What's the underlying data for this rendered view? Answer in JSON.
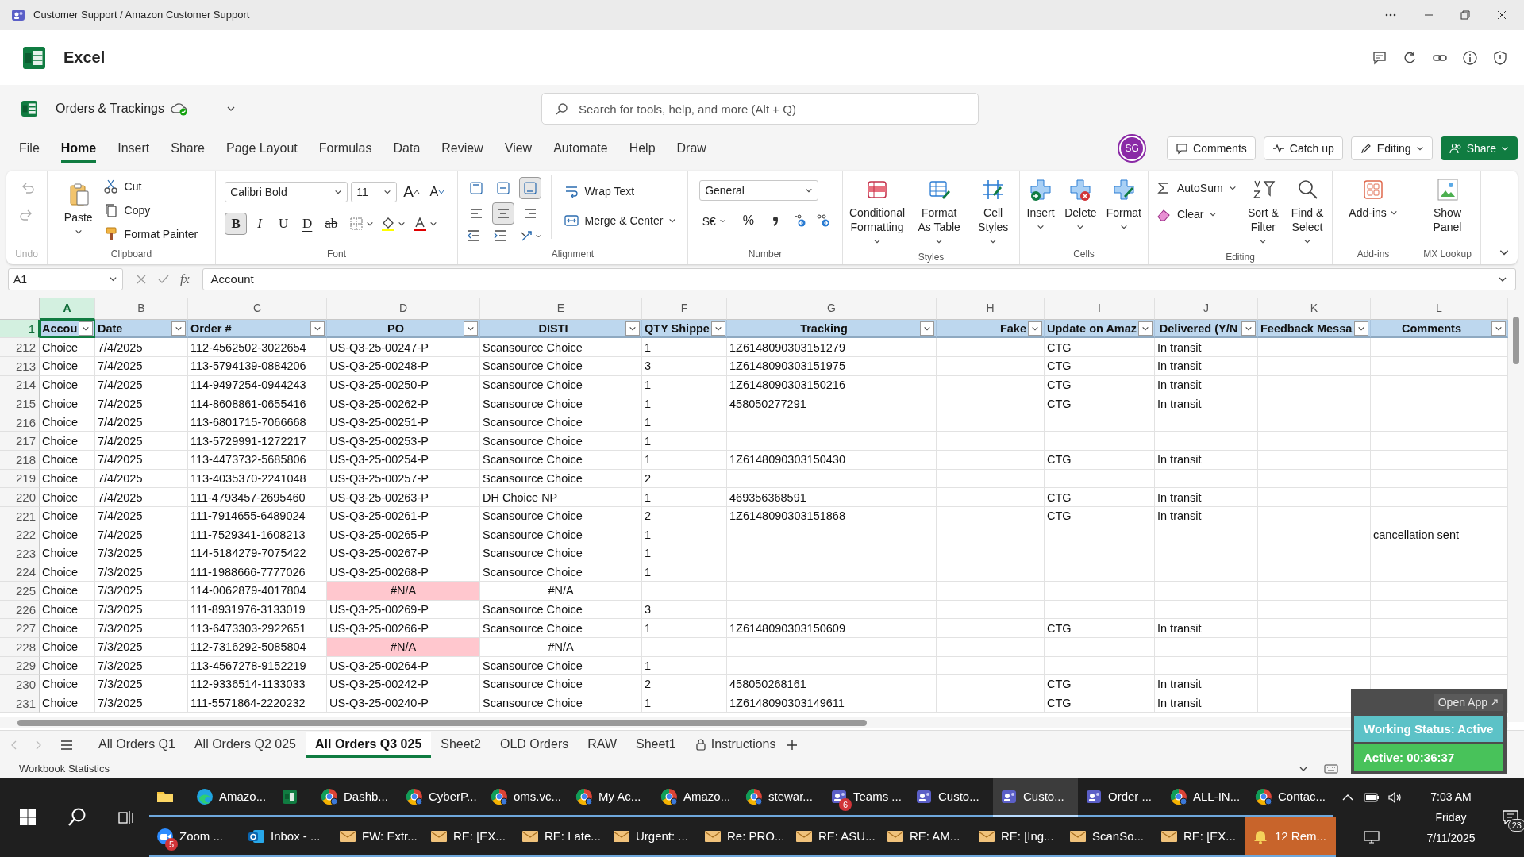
{
  "window": {
    "title": "Customer Support / Amazon Customer Support"
  },
  "app": {
    "name": "Excel"
  },
  "document": {
    "name": "Orders & Trackings"
  },
  "search": {
    "placeholder": "Search for tools, help, and more (Alt + Q)"
  },
  "menu_tabs": [
    {
      "label": "File",
      "selected": false
    },
    {
      "label": "Home",
      "selected": true
    },
    {
      "label": "Insert",
      "selected": false
    },
    {
      "label": "Share",
      "selected": false
    },
    {
      "label": "Page Layout",
      "selected": false
    },
    {
      "label": "Formulas",
      "selected": false
    },
    {
      "label": "Data",
      "selected": false
    },
    {
      "label": "Review",
      "selected": false
    },
    {
      "label": "View",
      "selected": false
    },
    {
      "label": "Automate",
      "selected": false
    },
    {
      "label": "Help",
      "selected": false
    },
    {
      "label": "Draw",
      "selected": false
    }
  ],
  "user": {
    "initials": "SG"
  },
  "actions": [
    {
      "label": "Comments",
      "kind": "outline"
    },
    {
      "label": "Catch up",
      "kind": "outline"
    },
    {
      "label": "Editing",
      "kind": "outline"
    },
    {
      "label": "Share",
      "kind": "primary"
    }
  ],
  "ribbon": {
    "groups": [
      {
        "kind": "undo",
        "label": "Undo",
        "disabled": true
      },
      {
        "kind": "clipboard",
        "label": "Clipboard",
        "paste": "Paste",
        "items": [
          "Cut",
          "Copy",
          "Format Painter"
        ]
      },
      {
        "kind": "font",
        "label": "Font",
        "font": "Calibri Bold",
        "size": "11",
        "size_buttons": [
          "A",
          "A"
        ],
        "styles": [
          {
            "label": "B",
            "selected": true
          },
          {
            "label": "I",
            "selected": false
          },
          {
            "label": "U",
            "selected": false
          },
          {
            "label": "D",
            "selected": false
          },
          {
            "label": "ab",
            "selected": false
          }
        ]
      },
      {
        "kind": "alignment",
        "label": "Alignment",
        "vertical": [
          {
            "selected": false
          },
          {
            "selected": false
          },
          {
            "selected": true
          }
        ],
        "horizontal": [
          {
            "selected": false
          },
          {
            "selected": true
          },
          {
            "selected": false
          }
        ],
        "wrap": "Wrap Text",
        "merge": "Merge & Center"
      },
      {
        "kind": "number",
        "label": "Number",
        "format": "General",
        "currency": "$€",
        "percent": "%"
      },
      {
        "kind": "large",
        "label": "Styles",
        "items": [
          {
            "label": "Conditional Formatting",
            "menu": true
          },
          {
            "label": "Format As Table",
            "menu": true
          },
          {
            "label": "Cell Styles",
            "menu": true
          }
        ]
      },
      {
        "kind": "large",
        "label": "Cells",
        "items": [
          {
            "label": "Insert",
            "menu": true
          },
          {
            "label": "Delete",
            "menu": true
          },
          {
            "label": "Format",
            "menu": true
          }
        ]
      },
      {
        "kind": "editing",
        "label": "Editing",
        "small": [
          "AutoSum",
          "Clear"
        ],
        "large": [
          "Sort & Filter",
          "Find & Select"
        ]
      },
      {
        "kind": "large",
        "label": "Add-ins",
        "items": [
          {
            "label": "Add-ins",
            "menu": true
          }
        ]
      },
      {
        "kind": "large",
        "label": "MX Lookup",
        "items": [
          {
            "label": "Show Panel",
            "menu": false
          }
        ]
      }
    ]
  },
  "formula_bar": {
    "cell": "A1",
    "fx": "fx",
    "value": "Account"
  },
  "sheet": {
    "columns": [
      {
        "label": "A",
        "selected": true
      },
      {
        "label": "B",
        "selected": false
      },
      {
        "label": "C",
        "selected": false
      },
      {
        "label": "D",
        "selected": false
      },
      {
        "label": "E",
        "selected": false
      },
      {
        "label": "F",
        "selected": false
      },
      {
        "label": "G",
        "selected": false
      },
      {
        "label": "H",
        "selected": false
      },
      {
        "label": "I",
        "selected": false
      },
      {
        "label": "J",
        "selected": false
      },
      {
        "label": "K",
        "selected": false
      },
      {
        "label": "L",
        "selected": false
      }
    ],
    "header_row": "1",
    "headers": [
      "Accou",
      "Date",
      "Order #",
      "PO",
      "DISTI",
      "QTY Shippe",
      "Tracking",
      "Fake",
      "Update on Amaz",
      "Delivered (Y/N",
      "Feedback Messa",
      "Comments"
    ],
    "rows": [
      {
        "row": "212",
        "po_error": false,
        "cells": [
          "Choice",
          "7/4/2025",
          "112-4562502-3022654",
          "US-Q3-25-00247-P",
          "Scansource Choice",
          "1",
          "1Z6148090303151279",
          null,
          "CTG",
          "In transit",
          null,
          null
        ]
      },
      {
        "row": "213",
        "po_error": false,
        "cells": [
          "Choice",
          "7/4/2025",
          "113-5794139-0884206",
          "US-Q3-25-00248-P",
          "Scansource Choice",
          "3",
          "1Z6148090303151975",
          null,
          "CTG",
          "In transit",
          null,
          null
        ]
      },
      {
        "row": "214",
        "po_error": false,
        "cells": [
          "Choice",
          "7/4/2025",
          "114-9497254-0944243",
          "US-Q3-25-00250-P",
          "Scansource Choice",
          "1",
          "1Z6148090303150216",
          null,
          "CTG",
          "In transit",
          null,
          null
        ]
      },
      {
        "row": "215",
        "po_error": false,
        "cells": [
          "Choice",
          "7/4/2025",
          "114-8608861-0655416",
          "US-Q3-25-00262-P",
          "Scansource Choice",
          "1",
          "458050277291",
          null,
          "CTG",
          "In transit",
          null,
          null
        ]
      },
      {
        "row": "216",
        "po_error": false,
        "cells": [
          "Choice",
          "7/4/2025",
          "113-6801715-7066668",
          "US-Q3-25-00251-P",
          "Scansource Choice",
          "1",
          null,
          null,
          null,
          null,
          null,
          null
        ]
      },
      {
        "row": "217",
        "po_error": false,
        "cells": [
          "Choice",
          "7/4/2025",
          "113-5729991-1272217",
          "US-Q3-25-00253-P",
          "Scansource Choice",
          "1",
          null,
          null,
          null,
          null,
          null,
          null
        ]
      },
      {
        "row": "218",
        "po_error": false,
        "cells": [
          "Choice",
          "7/4/2025",
          "113-4473732-5685806",
          "US-Q3-25-00254-P",
          "Scansource Choice",
          "1",
          "1Z6148090303150430",
          null,
          "CTG",
          "In transit",
          null,
          null
        ]
      },
      {
        "row": "219",
        "po_error": false,
        "cells": [
          "Choice",
          "7/4/2025",
          "113-4035370-2241048",
          "US-Q3-25-00257-P",
          "Scansource Choice",
          "2",
          null,
          null,
          null,
          null,
          null,
          null
        ]
      },
      {
        "row": "220",
        "po_error": false,
        "cells": [
          "Choice",
          "7/4/2025",
          "111-4793457-2695460",
          "US-Q3-25-00263-P",
          "DH Choice NP",
          "1",
          "469356368591",
          null,
          "CTG",
          "In transit",
          null,
          null
        ]
      },
      {
        "row": "221",
        "po_error": false,
        "cells": [
          "Choice",
          "7/4/2025",
          "111-7914655-6489024",
          "US-Q3-25-00261-P",
          "Scansource Choice",
          "2",
          "1Z6148090303151868",
          null,
          "CTG",
          "In transit",
          null,
          null
        ]
      },
      {
        "row": "222",
        "po_error": false,
        "cells": [
          "Choice",
          "7/4/2025",
          "111-7529341-1608213",
          "US-Q3-25-00265-P",
          "Scansource Choice",
          "1",
          null,
          null,
          null,
          null,
          null,
          "cancellation sent"
        ]
      },
      {
        "row": "223",
        "po_error": false,
        "cells": [
          "Choice",
          "7/3/2025",
          "114-5184279-7075422",
          "US-Q3-25-00267-P",
          "Scansource Choice",
          "1",
          null,
          null,
          null,
          null,
          null,
          null
        ]
      },
      {
        "row": "224",
        "po_error": false,
        "cells": [
          "Choice",
          "7/3/2025",
          "111-1988666-7777026",
          "US-Q3-25-00268-P",
          "Scansource Choice",
          "1",
          null,
          null,
          null,
          null,
          null,
          null
        ]
      },
      {
        "row": "225",
        "po_error": true,
        "cells": [
          "Choice",
          "7/3/2025",
          "114-0062879-4017804",
          "#N/A",
          "#N/A",
          null,
          null,
          null,
          null,
          null,
          null,
          null
        ]
      },
      {
        "row": "226",
        "po_error": false,
        "cells": [
          "Choice",
          "7/3/2025",
          "111-8931976-3133019",
          "US-Q3-25-00269-P",
          "Scansource Choice",
          "3",
          null,
          null,
          null,
          null,
          null,
          null
        ]
      },
      {
        "row": "227",
        "po_error": false,
        "cells": [
          "Choice",
          "7/3/2025",
          "113-6473303-2922651",
          "US-Q3-25-00266-P",
          "Scansource Choice",
          "1",
          "1Z6148090303150609",
          null,
          "CTG",
          "In transit",
          null,
          null
        ]
      },
      {
        "row": "228",
        "po_error": true,
        "cells": [
          "Choice",
          "7/3/2025",
          "112-7316292-5085804",
          "#N/A",
          "#N/A",
          null,
          null,
          null,
          null,
          null,
          null,
          null
        ]
      },
      {
        "row": "229",
        "po_error": false,
        "cells": [
          "Choice",
          "7/3/2025",
          "113-4567278-9152219",
          "US-Q3-25-00264-P",
          "Scansource Choice",
          "1",
          null,
          null,
          null,
          null,
          null,
          null
        ]
      },
      {
        "row": "230",
        "po_error": false,
        "cells": [
          "Choice",
          "7/3/2025",
          "112-9336514-1133033",
          "US-Q3-25-00242-P",
          "Scansource Choice",
          "2",
          "458050268161",
          null,
          "CTG",
          "In transit",
          null,
          null
        ]
      },
      {
        "row": "231",
        "po_error": false,
        "cells": [
          "Choice",
          "7/3/2025",
          "111-5571864-2220232",
          "US-Q3-25-00240-P",
          "Scansource Choice",
          "1",
          "1Z6148090303149611",
          null,
          "CTG",
          "In transit",
          null,
          null
        ]
      }
    ]
  },
  "sheet_tabs": [
    {
      "label": "All Orders Q1",
      "selected": false,
      "locked": false
    },
    {
      "label": "All Orders Q2 025",
      "selected": false,
      "locked": false
    },
    {
      "label": "All Orders Q3 025",
      "selected": true,
      "locked": false
    },
    {
      "label": "Sheet2",
      "selected": false,
      "locked": false
    },
    {
      "label": "OLD Orders",
      "selected": false,
      "locked": false
    },
    {
      "label": "RAW",
      "selected": false,
      "locked": false
    },
    {
      "label": "Sheet1",
      "selected": false,
      "locked": false
    },
    {
      "label": "Instructions",
      "selected": false,
      "locked": true
    }
  ],
  "status_bar": {
    "text": "Workbook Statistics"
  },
  "tracker": {
    "open": "Open App",
    "status": "Working Status: Active",
    "timer": "Active: 00:36:37"
  },
  "taskbar": {
    "top_row": [
      {
        "kind": "explorer",
        "selected": false,
        "alert": false
      },
      {
        "kind": "edge",
        "label": "Amazo...",
        "selected": false,
        "alert": false
      },
      {
        "kind": "excel",
        "selected": false,
        "alert": false
      },
      {
        "kind": "chrome",
        "label": "Dashb...",
        "selected": false,
        "alert": false
      },
      {
        "kind": "chrome",
        "label": "CyberP...",
        "selected": false,
        "alert": false
      },
      {
        "kind": "chrome",
        "label": "oms.vc...",
        "selected": false,
        "alert": false
      },
      {
        "kind": "chrome",
        "label": "My Ac...",
        "selected": false,
        "alert": false
      },
      {
        "kind": "chrome",
        "label": "Amazo...",
        "selected": false,
        "alert": false
      },
      {
        "kind": "chrome",
        "label": "stewar...",
        "selected": false,
        "alert": false
      },
      {
        "kind": "teams",
        "label": "Teams ...",
        "badge": "6",
        "selected": false,
        "alert": false
      },
      {
        "kind": "teams",
        "label": "Custo...",
        "selected": false,
        "alert": false
      },
      {
        "kind": "teams",
        "label": "Custo...",
        "selected": true,
        "alert": false
      },
      {
        "kind": "teams",
        "label": "Order ...",
        "selected": false,
        "alert": false
      },
      {
        "kind": "chrome",
        "label": "ALL-IN...",
        "selected": false,
        "alert": false
      },
      {
        "kind": "chrome",
        "label": "Contac...",
        "selected": false,
        "alert": false
      }
    ],
    "bottom_row": [
      {
        "kind": "zoom",
        "label": "Zoom ...",
        "badge": "5",
        "selected": false,
        "alert": false
      },
      {
        "kind": "outlook",
        "label": "Inbox - ...",
        "selected": false,
        "alert": false
      },
      {
        "kind": "mail",
        "label": "FW: Extr...",
        "selected": false,
        "alert": false
      },
      {
        "kind": "mail",
        "label": "RE: [EX...",
        "selected": false,
        "alert": false
      },
      {
        "kind": "mail",
        "label": "RE: Late...",
        "selected": false,
        "alert": false
      },
      {
        "kind": "mail",
        "label": "Urgent: ...",
        "selected": false,
        "alert": false
      },
      {
        "kind": "mail",
        "label": "Re: PRO...",
        "selected": false,
        "alert": false
      },
      {
        "kind": "mail",
        "label": "RE: ASU...",
        "selected": false,
        "alert": false
      },
      {
        "kind": "mail",
        "label": "RE: AM...",
        "selected": false,
        "alert": false
      },
      {
        "kind": "mail",
        "label": "RE: [Ing...",
        "selected": false,
        "alert": false
      },
      {
        "kind": "mail",
        "label": "ScanSo...",
        "selected": false,
        "alert": false
      },
      {
        "kind": "mail",
        "label": "RE: [EX...",
        "selected": false,
        "alert": false
      },
      {
        "kind": "bell",
        "label": "12 Rem...",
        "selected": false,
        "alert": true
      }
    ],
    "time": "7:03 AM",
    "day": "Friday",
    "date": "7/11/2025",
    "notifications": "23"
  }
}
